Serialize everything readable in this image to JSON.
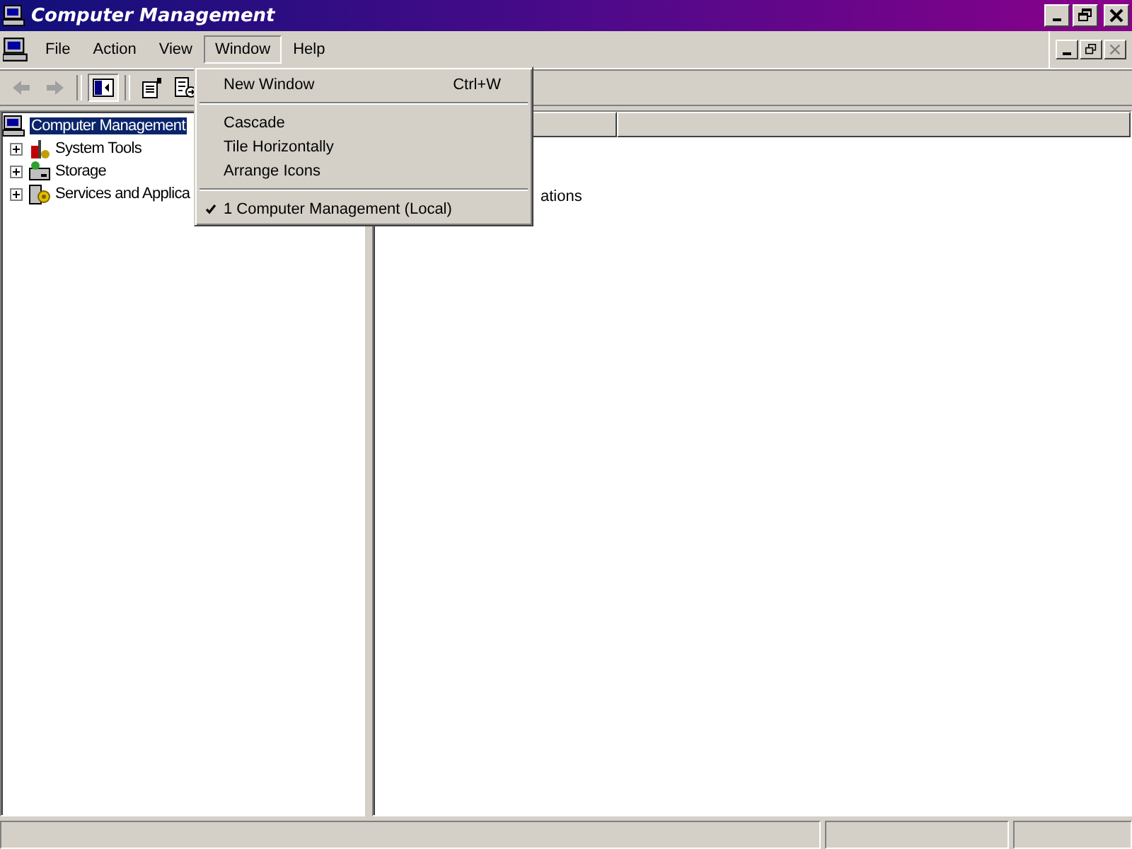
{
  "window": {
    "title": "Computer Management"
  },
  "menu_bar": [
    {
      "label": "File",
      "selected": false
    },
    {
      "label": "Action",
      "selected": false
    },
    {
      "label": "View",
      "selected": false
    },
    {
      "label": "Window",
      "selected": true
    },
    {
      "label": "Help",
      "selected": false
    }
  ],
  "toolbar": [
    {
      "kind": "back",
      "disabled": true,
      "pressed": false
    },
    {
      "kind": "forward",
      "disabled": true,
      "pressed": false
    },
    {
      "kind": "separator"
    },
    {
      "kind": "tree",
      "pressed": true
    },
    {
      "kind": "separator"
    },
    {
      "kind": "properties",
      "pressed": false
    },
    {
      "kind": "export",
      "pressed": false
    }
  ],
  "tree": {
    "label": "Computer Management",
    "selected": true,
    "children": [
      {
        "label": "System Tools",
        "kind": "tools",
        "expanded": false,
        "selected": false
      },
      {
        "label": "Storage",
        "kind": "storage",
        "expanded": false,
        "selected": false
      },
      {
        "label": "Services and Applica",
        "kind": "services",
        "expanded": false,
        "selected": false
      }
    ]
  },
  "list": {
    "items": [
      "ations"
    ]
  },
  "window_menu": {
    "items": [
      {
        "kind": "item",
        "label": "New Window",
        "shortcut": "Ctrl+W",
        "checked": false
      },
      {
        "kind": "separator"
      },
      {
        "kind": "item",
        "label": "Cascade",
        "checked": false
      },
      {
        "kind": "item",
        "label": "Tile Horizontally",
        "checked": false
      },
      {
        "kind": "item",
        "label": "Arrange Icons",
        "checked": false
      },
      {
        "kind": "separator"
      },
      {
        "kind": "item",
        "label": "1 Computer Management (Local)",
        "checked": true
      }
    ]
  }
}
